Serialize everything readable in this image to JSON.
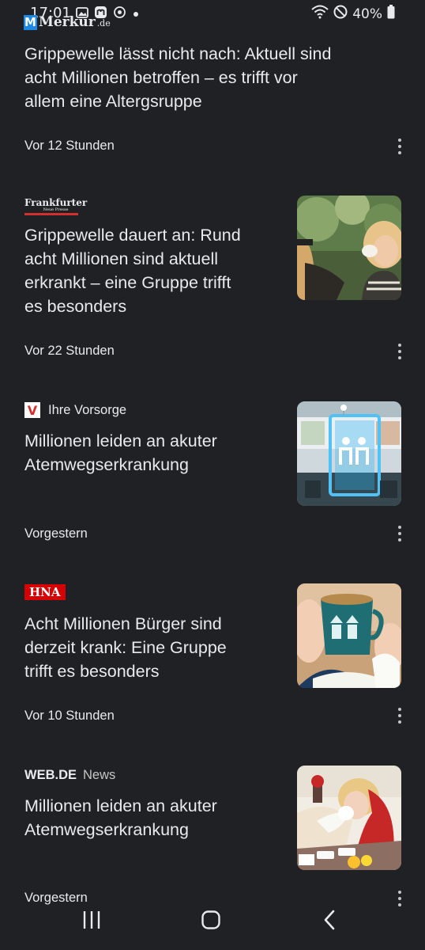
{
  "status_bar": {
    "time": "17:01",
    "battery": "40%",
    "icons_left": [
      "image-icon",
      "mastodon-icon",
      "sync-icon",
      "dot-icon"
    ],
    "icons_right": [
      "wifi-icon",
      "do-not-disturb-icon",
      "battery-icon"
    ]
  },
  "articles": [
    {
      "source": "Merkur.de",
      "source_logo_letter": "M",
      "source_logo_main": "Merkur",
      "source_logo_suffix": ".de",
      "headline_lines": [
        "Grippewelle lässt nicht nach: Aktuell sind",
        "acht Millionen betroffen – es trifft vor",
        "allem eine Altergsruppe"
      ],
      "time": "Vor 12 Stunden"
    },
    {
      "source": "Frankfurter Neue Presse",
      "source_logo_main": "Frankfurter",
      "source_logo_sub": "Neue Presse",
      "headline_lines": [
        "Grippewelle dauert an: Rund",
        "acht Millionen sind aktuell",
        "erkrankt – eine Gruppe trifft",
        "es besonders"
      ],
      "time": "Vor 22 Stunden",
      "thumbnail": "woman-blowing-nose-outdoors"
    },
    {
      "source": "Ihre Vorsorge",
      "source_logo_letter": "V",
      "headline_lines": [
        "Millionen leiden an akuter",
        "Atemwegserkrankung"
      ],
      "time": "Vorgestern",
      "thumbnail": "waiting-room-sign"
    },
    {
      "source": "HNA",
      "headline_lines": [
        "Acht Millionen Bürger sind",
        "derzeit krank: Eine Gruppe",
        "trifft es besonders"
      ],
      "time": "Vor 10 Stunden",
      "thumbnail": "tea-mug-tissues"
    },
    {
      "source": "WEB.DE",
      "source_suffix": "News",
      "headline_lines": [
        "Millionen leiden an akuter",
        "Atemwegserkrankung"
      ],
      "time": "Vorgestern",
      "thumbnail": "sick-woman-in-bed"
    }
  ],
  "nav": {
    "buttons": [
      "recent-apps",
      "home",
      "back"
    ]
  },
  "colors": {
    "background": "#202124",
    "text": "#e8eaed",
    "accent_blue": "#1e88e5",
    "hna_red": "#d50000"
  }
}
